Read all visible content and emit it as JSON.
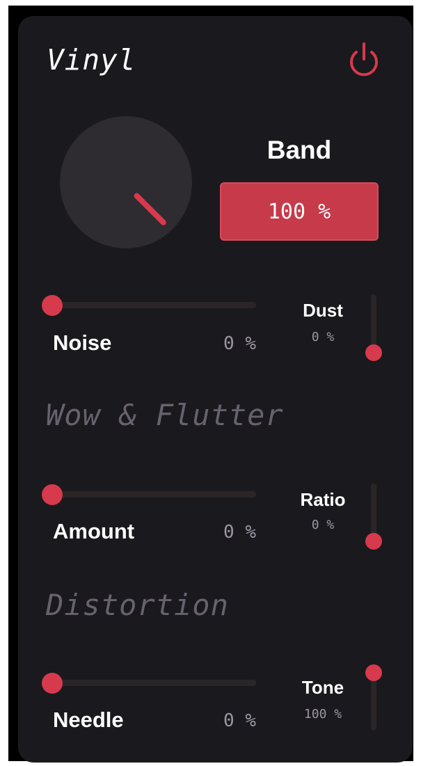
{
  "plugin": {
    "title": "Vinyl",
    "power_icon": "power-icon",
    "accent_color": "#d63a4c",
    "panel_color": "#1a191d"
  },
  "band": {
    "label": "Band",
    "value": "100 %",
    "level": 1.0
  },
  "noise_section": {
    "horizontal": {
      "label": "Noise",
      "value": "0 %",
      "level": 0.0
    },
    "vertical": {
      "label": "Dust",
      "value": "0 %",
      "level": 0.0
    }
  },
  "wow_section": {
    "heading": "Wow & Flutter",
    "horizontal": {
      "label": "Amount",
      "value": "0 %",
      "level": 0.0
    },
    "vertical": {
      "label": "Ratio",
      "value": "0 %",
      "level": 0.0
    }
  },
  "distortion_section": {
    "heading": "Distortion",
    "horizontal": {
      "label": "Needle",
      "value": "0 %",
      "level": 0.0
    },
    "vertical": {
      "label": "Tone",
      "value": "100 %",
      "level": 1.0
    }
  }
}
